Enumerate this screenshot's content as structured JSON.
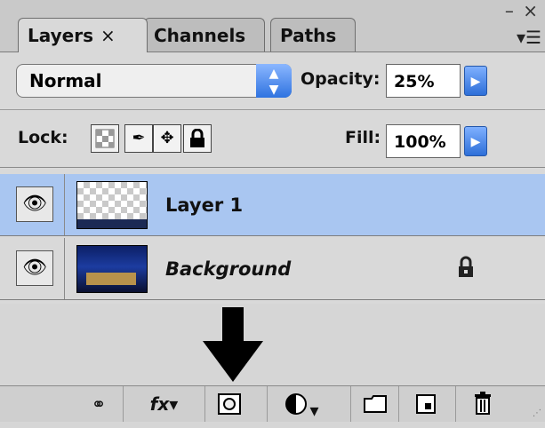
{
  "tabs": [
    {
      "label": "Layers",
      "close": "×",
      "active": true
    },
    {
      "label": "Channels",
      "active": false
    },
    {
      "label": "Paths",
      "active": false
    }
  ],
  "window_controls": "– ×",
  "blend_mode": {
    "value": "Normal"
  },
  "opacity": {
    "label": "Opacity:",
    "value": "25%"
  },
  "lock": {
    "label": "Lock:"
  },
  "fill": {
    "label": "Fill:",
    "value": "100%"
  },
  "layers": [
    {
      "name": "Layer 1",
      "selected": true
    },
    {
      "name": "Background",
      "selected": false,
      "locked": true
    }
  ],
  "footer": {
    "buttons": [
      "link-layers",
      "layer-style",
      "layer-mask",
      "adjustment-layer",
      "new-group",
      "new-layer",
      "delete-layer"
    ],
    "fx_label": "fx"
  },
  "colors": {
    "selection": "#a9c6f1",
    "accent_blue": "#2f73e0",
    "panel_bg": "#d9d9d9"
  }
}
